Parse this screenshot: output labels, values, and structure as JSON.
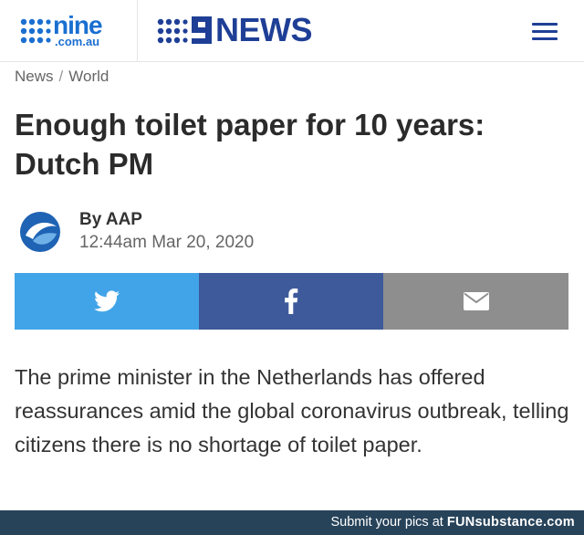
{
  "header": {
    "logo_nine": {
      "word": "nine",
      "sub": ".com.au"
    },
    "logo_news": {
      "word": "NEWS"
    },
    "menu_icon": "hamburger-menu-icon",
    "colors": {
      "nine_blue": "#1a6fd0",
      "news_navy": "#1f3f96"
    }
  },
  "breadcrumb": {
    "items": [
      "News",
      "World"
    ],
    "separator": "/"
  },
  "article": {
    "title": "Enough toilet paper for 10 years: Dutch PM",
    "author": "By AAP",
    "date": "12:44am Mar 20, 2020",
    "avatar_icon": "aap-logo-icon",
    "body": "The prime minister in the Netherlands has offered reassurances amid the global coronavirus outbreak, telling citizens there is no shortage of toilet paper."
  },
  "share": {
    "buttons": [
      {
        "network": "twitter",
        "icon": "twitter-icon",
        "color": "#42a4e8"
      },
      {
        "network": "facebook",
        "icon": "facebook-icon",
        "color": "#3e5a9b"
      },
      {
        "network": "email",
        "icon": "email-icon",
        "color": "#8e8e8e"
      }
    ]
  },
  "footer": {
    "text": "Submit your pics at ",
    "brand": "FUNsubstance.com",
    "color": "#27435a"
  }
}
